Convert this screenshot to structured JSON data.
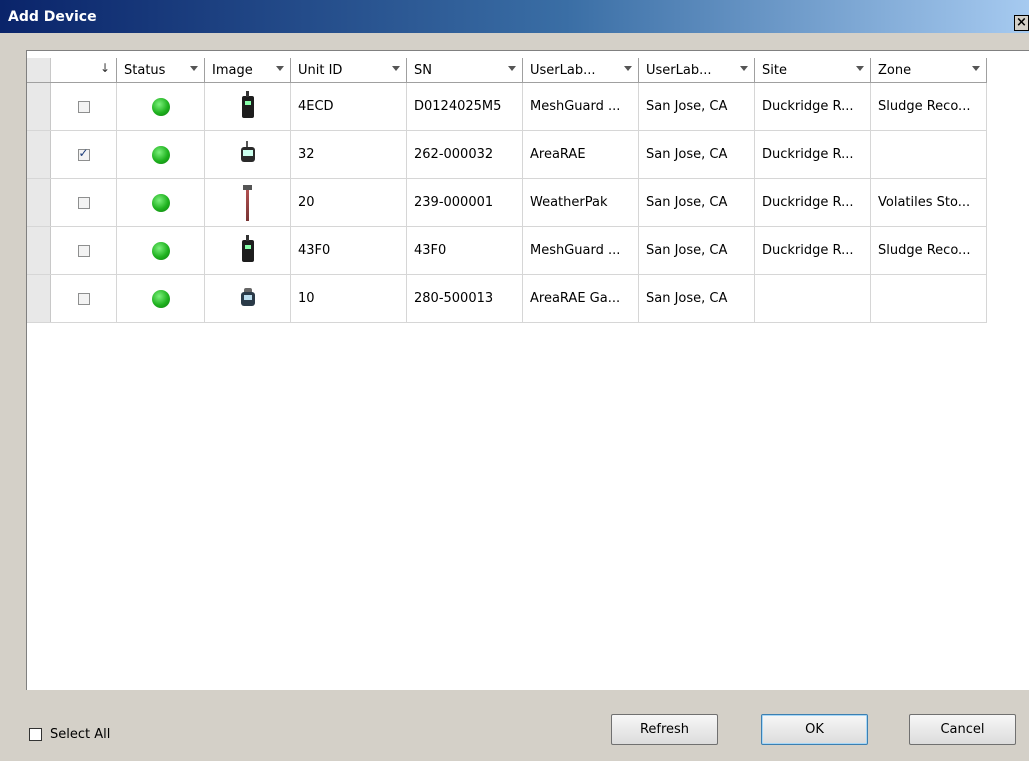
{
  "window": {
    "title": "Add Device",
    "close_glyph": "×"
  },
  "columns": [
    {
      "key": "select",
      "label": "",
      "sort_glyph": "↓"
    },
    {
      "key": "status",
      "label": "Status"
    },
    {
      "key": "image",
      "label": "Image"
    },
    {
      "key": "unit_id",
      "label": "Unit ID"
    },
    {
      "key": "sn",
      "label": "SN"
    },
    {
      "key": "userlab1",
      "label": "UserLab..."
    },
    {
      "key": "userlab2",
      "label": "UserLab..."
    },
    {
      "key": "site",
      "label": "Site"
    },
    {
      "key": "zone",
      "label": "Zone"
    }
  ],
  "rows": [
    {
      "checked": false,
      "status": "green-status-icon",
      "image": "handheld-monitor-icon",
      "unit_id": "4ECD",
      "sn": "D0124025M5",
      "userlab1": "MeshGuard ...",
      "userlab2": "San Jose, CA",
      "site": "Duckridge R...",
      "zone": "Sludge Reco..."
    },
    {
      "checked": true,
      "status": "green-status-icon",
      "image": "area-monitor-icon",
      "unit_id": "32",
      "sn": "262-000032",
      "userlab1": "AreaRAE",
      "userlab2": "San Jose, CA",
      "site": "Duckridge R...",
      "zone": ""
    },
    {
      "checked": false,
      "status": "green-status-icon",
      "image": "weather-station-icon",
      "unit_id": "20",
      "sn": "239-000001",
      "userlab1": "WeatherPak",
      "userlab2": "San Jose, CA",
      "site": "Duckridge R...",
      "zone": "Volatiles Sto..."
    },
    {
      "checked": false,
      "status": "green-status-icon",
      "image": "handheld-monitor-icon",
      "unit_id": "43F0",
      "sn": "43F0",
      "userlab1": "MeshGuard ...",
      "userlab2": "San Jose, CA",
      "site": "Duckridge R...",
      "zone": "Sludge Reco..."
    },
    {
      "checked": false,
      "status": "green-status-icon",
      "image": "gas-monitor-icon",
      "unit_id": "10",
      "sn": "280-500013",
      "userlab1": "AreaRAE Ga...",
      "userlab2": "San Jose, CA",
      "site": "",
      "zone": ""
    }
  ],
  "footer": {
    "select_all_label": "Select All",
    "select_all_checked": false,
    "refresh_label": "Refresh",
    "ok_label": "OK",
    "cancel_label": "Cancel"
  },
  "colors": {
    "status_ok": "#1fb21f",
    "title_start": "#0a246a",
    "title_end": "#a6caf0"
  }
}
